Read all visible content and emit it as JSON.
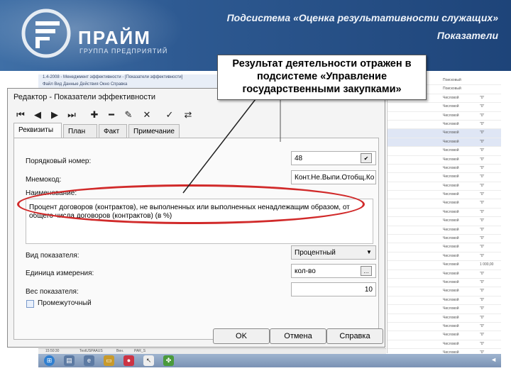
{
  "slide": {
    "brand_name": "ПРАЙМ",
    "brand_sub": "ГРУППА ПРЕДПРИЯТИЙ",
    "title_line1": "Подсистема «Оценка результативности служащих»",
    "title_line2": "Показатели",
    "callout": "Результат деятельности отражен в подсистеме «Управление государственными закупками»"
  },
  "app": {
    "strip_line1": "1.4-2008 - Менеджмент эффективности - [Показатели эффективности]",
    "strip_line2": "Файл   Вид   Данные   Действия   Окно   Справка"
  },
  "dialog": {
    "title": "Редактор - Показатели эффективности",
    "toolbar": [
      "first-icon",
      "prev-icon",
      "next-icon",
      "last-icon",
      "add-icon",
      "delete-icon",
      "edit-icon",
      "cancel-icon",
      "confirm-icon",
      "refresh-icon"
    ],
    "tabs": [
      "Реквизиты",
      "План",
      "Факт",
      "Примечание"
    ],
    "active_tab": "Реквизиты",
    "fields": {
      "order_label": "Порядковый номер:",
      "order_value": "48",
      "mnemo_label": "Мнемокод:",
      "mnemo_value": "Конт.Не.Выпи.Отобщ.Ко",
      "name_label": "Наименование:",
      "name_value": "Процент договоров (контрактов), не выполненных или выполненных ненадлежащим образом, от общего числа договоров (контрактов) (в %)",
      "type_label": "Вид показателя:",
      "type_value": "Процентный",
      "unit_label": "Единица измерения:",
      "unit_value": "кол-во",
      "weight_label": "Вес показателя:",
      "weight_value": "10",
      "intermediate_label": "Промежуточный"
    },
    "buttons": {
      "ok": "OK",
      "cancel": "Отмена",
      "help": "Справка"
    }
  },
  "background_list": {
    "col_type": [
      "Поисковый",
      "Поисковый",
      "Числовой",
      "Числовой",
      "Числовой",
      "Числовой",
      "Числовой",
      "Числовой",
      "Числовой",
      "Числовой",
      "Числовой",
      "Числовой",
      "Числовой",
      "Числовой",
      "Числовой",
      "Числовой",
      "Числовой",
      "Числовой",
      "Числовой",
      "Числовой",
      "Числовой",
      "Числовой",
      "Числовой",
      "Числовой",
      "Числовой",
      "Числовой",
      "Числовой",
      "Числовой",
      "Числовой",
      "Числовой",
      "Числовой",
      "Числовой",
      "Числовой",
      "Числовой"
    ],
    "col_unit": [
      "",
      "",
      "\"0\"",
      "\"0\"",
      "\"0\"",
      "\"0\"",
      "\"0\"",
      "\"0\"",
      "\"0\"",
      "\"0\"",
      "\"0\"",
      "\"0\"",
      "\"0\"",
      "\"0\"",
      "\"0\"",
      "\"0\"",
      "\"0\"",
      "\"0\"",
      "\"0\"",
      "\"0\"",
      "\"0\"",
      "1 000,00",
      "\"0\"",
      "\"0\"",
      "\"0\"",
      "\"0\"",
      "\"0\"",
      "\"0\"",
      "\"0\"",
      "\"0\"",
      "\"0\"",
      "\"0\"",
      "\"0\"",
      "\"0\""
    ]
  },
  "taskbar": {
    "time": "15:50:30",
    "user": "TestUSPAAUS",
    "mode": "Вен.",
    "code": "PAR_S"
  }
}
